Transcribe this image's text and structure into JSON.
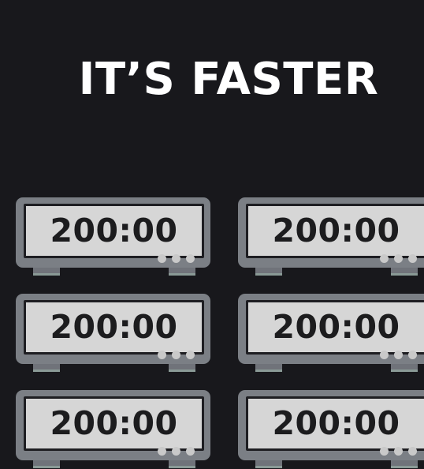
{
  "headline": "IT’S FASTER",
  "clocks": [
    {
      "time": "200:00"
    },
    {
      "time": "200:00"
    },
    {
      "time": "200:00"
    },
    {
      "time": "200:00"
    },
    {
      "time": "200:00"
    },
    {
      "time": "200:00"
    }
  ]
}
